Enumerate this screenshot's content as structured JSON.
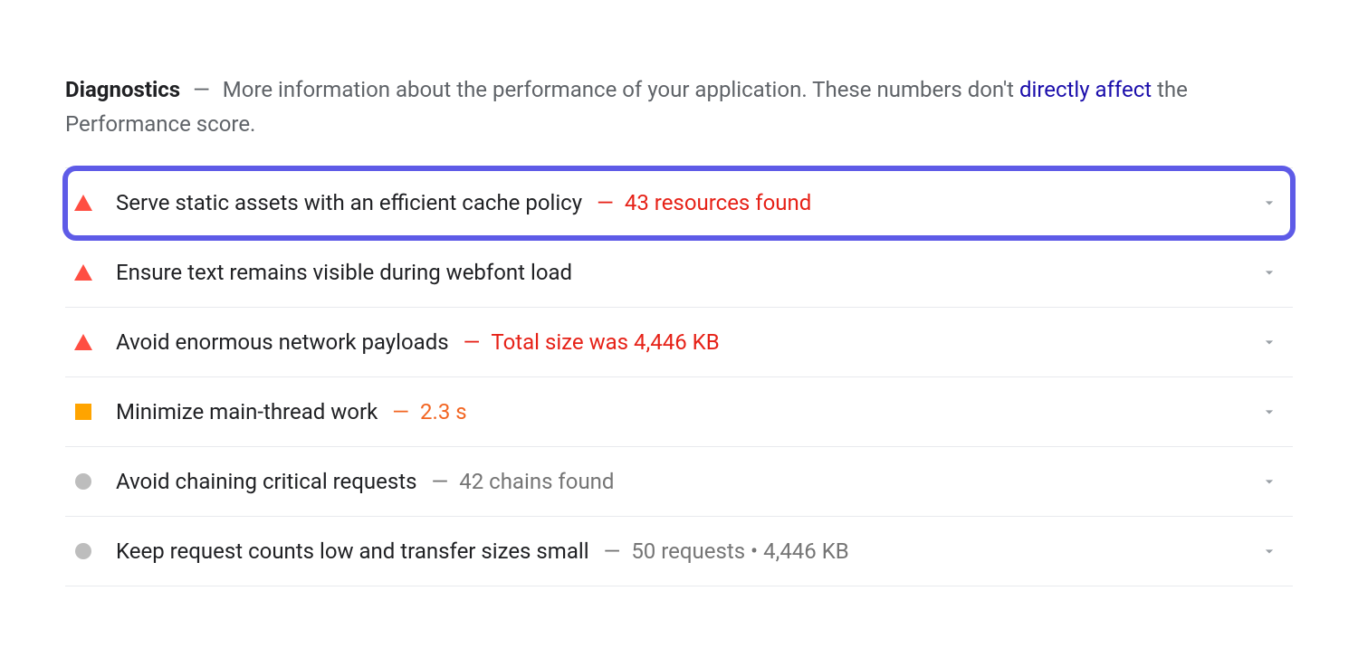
{
  "header": {
    "title": "Diagnostics",
    "description_prefix": "More information about the performance of your application. These numbers don't ",
    "link_text": "directly affect",
    "description_suffix": " the Performance score."
  },
  "audits": [
    {
      "severity": "red",
      "icon": "triangle-red",
      "title": "Serve static assets with an efficient cache policy",
      "detail": "43 resources found",
      "highlighted": true
    },
    {
      "severity": "red",
      "icon": "triangle-red",
      "title": "Ensure text remains visible during webfont load",
      "detail": "",
      "highlighted": false
    },
    {
      "severity": "red",
      "icon": "triangle-red",
      "title": "Avoid enormous network payloads",
      "detail": "Total size was 4,446 KB",
      "highlighted": false
    },
    {
      "severity": "orange",
      "icon": "square-orange",
      "title": "Minimize main-thread work",
      "detail": "2.3 s",
      "highlighted": false
    },
    {
      "severity": "gray",
      "icon": "circle-gray",
      "title": "Avoid chaining critical requests",
      "detail": "42 chains found",
      "highlighted": false
    },
    {
      "severity": "gray",
      "icon": "circle-gray",
      "title": "Keep request counts low and transfer sizes small",
      "detail": "50 requests • 4,446 KB",
      "highlighted": false
    }
  ]
}
